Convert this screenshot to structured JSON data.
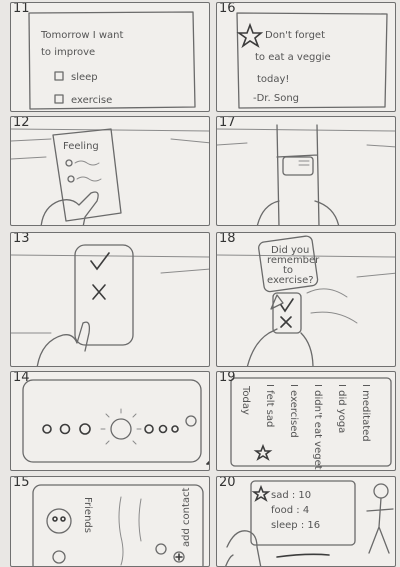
{
  "panels": {
    "p11": {
      "number": "11",
      "line1": "Tomorrow I want",
      "line2": "to improve",
      "opt1": "sleep",
      "opt2": "exercise"
    },
    "p16": {
      "number": "16",
      "line1": "Don't forget",
      "line2": "to eat a veggie",
      "line3": "today!",
      "line4": "-Dr. Song"
    },
    "p12": {
      "number": "12",
      "title": "Feeling"
    },
    "p17": {
      "number": "17"
    },
    "p13": {
      "number": "13"
    },
    "p18": {
      "number": "18",
      "bubble1": "Did you",
      "bubble2": "remember",
      "bubble3": "to",
      "bubble4": "exercise?"
    },
    "p14": {
      "number": "14"
    },
    "p19": {
      "number": "19",
      "lines": [
        "Today",
        "I felt sad",
        "I exercised",
        "I didn't eat vegetables",
        "I did yoga",
        "I meditated"
      ]
    },
    "p15": {
      "number": "15",
      "label1": "Friends",
      "label2": "add contact"
    },
    "p20": {
      "number": "20",
      "stat1": "sad : 10",
      "stat2": "food : 4",
      "stat3": "sleep : 16"
    }
  }
}
